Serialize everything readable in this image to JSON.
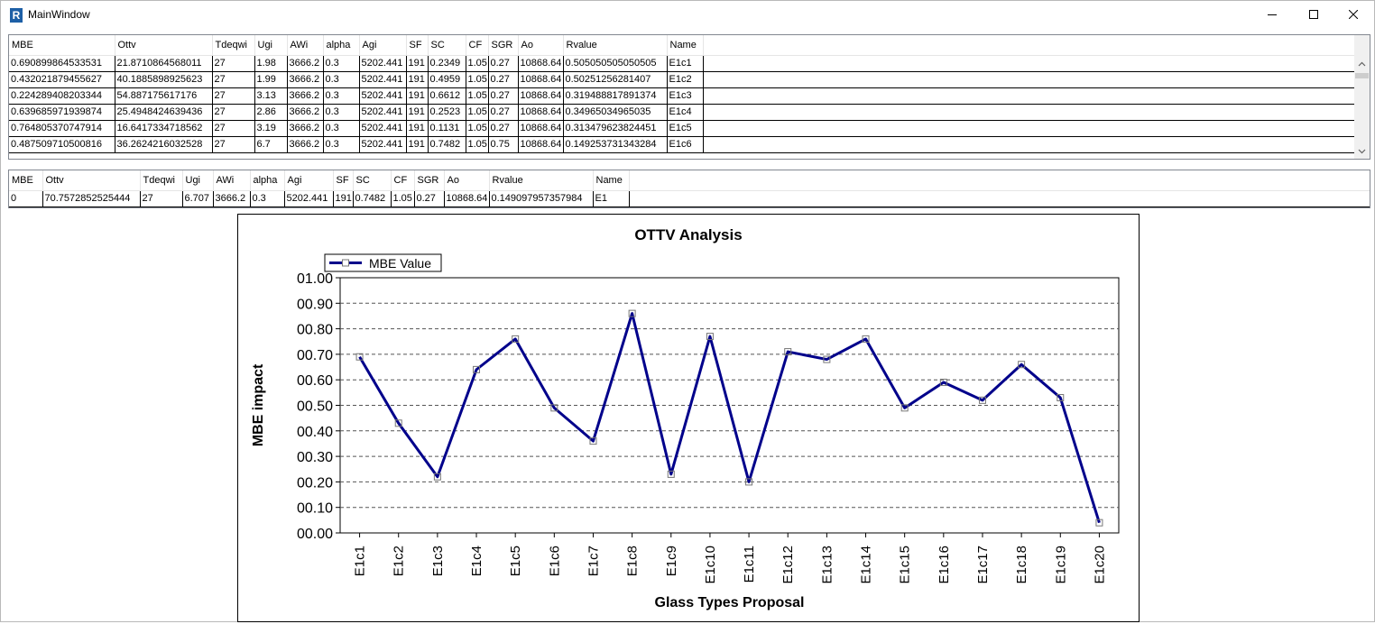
{
  "window": {
    "title": "MainWindow",
    "icon": "revit-r-icon",
    "icon_glyph": "R"
  },
  "grid1": {
    "columns": [
      "MBE",
      "Ottv",
      "Tdeqwi",
      "Ugi",
      "AWi",
      "alpha",
      "Agi",
      "SF",
      "SC",
      "CF",
      "SGR",
      "Ao",
      "Rvalue",
      "Name"
    ],
    "rows": [
      [
        "0.690899864533531",
        "21.8710864568011",
        "27",
        "1.98",
        "3666.2",
        "0.3",
        "5202.441",
        "191",
        "0.2349",
        "1.05",
        "0.27",
        "10868.64",
        "0.505050505050505",
        "E1c1"
      ],
      [
        "0.432021879455627",
        "40.1885898925623",
        "27",
        "1.99",
        "3666.2",
        "0.3",
        "5202.441",
        "191",
        "0.4959",
        "1.05",
        "0.27",
        "10868.64",
        "0.50251256281407",
        "E1c2"
      ],
      [
        "0.224289408203344",
        "54.887175617176",
        "27",
        "3.13",
        "3666.2",
        "0.3",
        "5202.441",
        "191",
        "0.6612",
        "1.05",
        "0.27",
        "10868.64",
        "0.319488817891374",
        "E1c3"
      ],
      [
        "0.639685971939874",
        "25.4948424639436",
        "27",
        "2.86",
        "3666.2",
        "0.3",
        "5202.441",
        "191",
        "0.2523",
        "1.05",
        "0.27",
        "10868.64",
        "0.34965034965035",
        "E1c4"
      ],
      [
        "0.764805370747914",
        "16.6417334718562",
        "27",
        "3.19",
        "3666.2",
        "0.3",
        "5202.441",
        "191",
        "0.1131",
        "1.05",
        "0.27",
        "10868.64",
        "0.313479623824451",
        "E1c5"
      ],
      [
        "0.487509710500816",
        "36.2624216032528",
        "27",
        "6.7",
        "3666.2",
        "0.3",
        "5202.441",
        "191",
        "0.7482",
        "1.05",
        "0.75",
        "10868.64",
        "0.149253731343284",
        "E1c6"
      ]
    ]
  },
  "grid2": {
    "columns": [
      "MBE",
      "Ottv",
      "Tdeqwi",
      "Ugi",
      "AWi",
      "alpha",
      "Agi",
      "SF",
      "SC",
      "CF",
      "SGR",
      "Ao",
      "Rvalue",
      "Name"
    ],
    "rows": [
      [
        "0",
        "70.7572852525444",
        "27",
        "6.707",
        "3666.2",
        "0.3",
        "5202.441",
        "191",
        "0.7482",
        "1.05",
        "0.27",
        "10868.64",
        "0.149097957357984",
        "E1"
      ]
    ]
  },
  "chart_data": {
    "type": "line",
    "title": "OTTV Analysis",
    "xlabel": "Glass Types Proposal",
    "ylabel": "MBE impact",
    "categories": [
      "E1c1",
      "E1c2",
      "E1c3",
      "E1c4",
      "E1c5",
      "E1c6",
      "E1c7",
      "E1c8",
      "E1c9",
      "E1c10",
      "E1c11",
      "E1c12",
      "E1c13",
      "E1c14",
      "E1c15",
      "E1c16",
      "E1c17",
      "E1c18",
      "E1c19",
      "E1c20"
    ],
    "series": [
      {
        "name": "MBE Value",
        "values": [
          0.69,
          0.43,
          0.22,
          0.64,
          0.76,
          0.49,
          0.36,
          0.86,
          0.23,
          0.77,
          0.2,
          0.71,
          0.68,
          0.76,
          0.49,
          0.59,
          0.52,
          0.66,
          0.53,
          0.04
        ],
        "color": "#00008b"
      }
    ],
    "yticks": [
      "00.00",
      "00.10",
      "00.20",
      "00.30",
      "00.40",
      "00.50",
      "00.60",
      "00.70",
      "00.80",
      "00.90",
      "01.00"
    ],
    "ylim": [
      0,
      1
    ],
    "grid": "horizontal dashed",
    "legend": "top-left"
  }
}
